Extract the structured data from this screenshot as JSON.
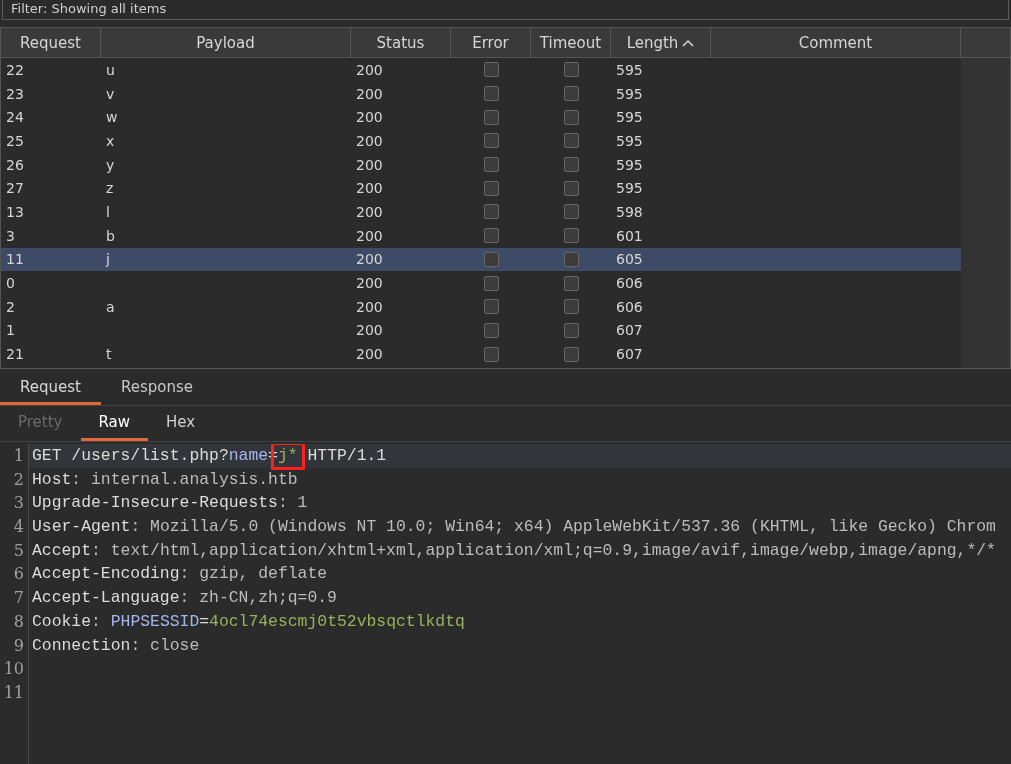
{
  "filter": {
    "text": "Filter: Showing all items"
  },
  "table": {
    "columns": [
      {
        "label": "Request",
        "sorted_ascending": false
      },
      {
        "label": "Payload",
        "sorted_ascending": false
      },
      {
        "label": "Status",
        "sorted_ascending": false
      },
      {
        "label": "Error",
        "sorted_ascending": false
      },
      {
        "label": "Timeout",
        "sorted_ascending": false
      },
      {
        "label": "Length",
        "sorted_ascending": true
      },
      {
        "label": "Comment",
        "sorted_ascending": false
      }
    ],
    "rows": [
      {
        "request": "22",
        "payload": "u",
        "status": "200",
        "error": false,
        "timeout": false,
        "length": "595",
        "selected": false
      },
      {
        "request": "23",
        "payload": "v",
        "status": "200",
        "error": false,
        "timeout": false,
        "length": "595",
        "selected": false
      },
      {
        "request": "24",
        "payload": "w",
        "status": "200",
        "error": false,
        "timeout": false,
        "length": "595",
        "selected": false
      },
      {
        "request": "25",
        "payload": "x",
        "status": "200",
        "error": false,
        "timeout": false,
        "length": "595",
        "selected": false
      },
      {
        "request": "26",
        "payload": "y",
        "status": "200",
        "error": false,
        "timeout": false,
        "length": "595",
        "selected": false
      },
      {
        "request": "27",
        "payload": "z",
        "status": "200",
        "error": false,
        "timeout": false,
        "length": "595",
        "selected": false
      },
      {
        "request": "13",
        "payload": "l",
        "status": "200",
        "error": false,
        "timeout": false,
        "length": "598",
        "selected": false
      },
      {
        "request": "3",
        "payload": "b",
        "status": "200",
        "error": false,
        "timeout": false,
        "length": "601",
        "selected": false
      },
      {
        "request": "11",
        "payload": "j",
        "status": "200",
        "error": false,
        "timeout": false,
        "length": "605",
        "selected": true
      },
      {
        "request": "0",
        "status": "200",
        "error": false,
        "timeout": false,
        "length": "606",
        "selected": false
      },
      {
        "request": "2",
        "payload": "a",
        "status": "200",
        "error": false,
        "timeout": false,
        "length": "606",
        "selected": false
      },
      {
        "request": "1",
        "status": "200",
        "error": false,
        "timeout": false,
        "length": "607",
        "selected": false
      },
      {
        "request": "21",
        "payload": "t",
        "status": "200",
        "error": false,
        "timeout": false,
        "length": "607",
        "selected": false
      }
    ]
  },
  "tabs": [
    {
      "label": "Request",
      "selected": true
    },
    {
      "label": "Response",
      "selected": false
    }
  ],
  "view_tabs": [
    {
      "label": "Pretty",
      "selected": false,
      "disabled": true
    },
    {
      "label": "Raw",
      "selected": true,
      "disabled": false
    },
    {
      "label": "Hex",
      "selected": false,
      "disabled": false
    }
  ],
  "editor": {
    "lines": [
      {
        "number": "1",
        "current": true,
        "segments": [
          {
            "text": "GET /users/list.php?",
            "kind": "plain"
          },
          {
            "text": "name",
            "kind": "param"
          },
          {
            "text": "=",
            "kind": "plain"
          },
          {
            "text": "j*",
            "kind": "param_value",
            "highlighted": true
          },
          {
            "text": " HTTP/1.1",
            "kind": "plain"
          }
        ]
      },
      {
        "number": "2",
        "current": false,
        "segments": [
          {
            "text": "Host",
            "kind": "header"
          },
          {
            "text": ": internal.analysis.htb",
            "kind": "value"
          }
        ]
      },
      {
        "number": "3",
        "current": false,
        "segments": [
          {
            "text": "Upgrade-Insecure-Requests",
            "kind": "header"
          },
          {
            "text": ": 1",
            "kind": "value"
          }
        ]
      },
      {
        "number": "4",
        "current": false,
        "segments": [
          {
            "text": "User-Agent",
            "kind": "header"
          },
          {
            "text": ": Mozilla/5.0 (Windows NT 10.0; Win64; x64) AppleWebKit/537.36 (KHTML, like Gecko) Chrom",
            "kind": "value"
          }
        ]
      },
      {
        "number": "5",
        "current": false,
        "segments": [
          {
            "text": "Accept",
            "kind": "header"
          },
          {
            "text": ": text/html,application/xhtml+xml,application/xml;q=0.9,image/avif,image/webp,image/apng,*/*",
            "kind": "value"
          }
        ]
      },
      {
        "number": "6",
        "current": false,
        "segments": [
          {
            "text": "Accept-Encoding",
            "kind": "header"
          },
          {
            "text": ": gzip, deflate",
            "kind": "value"
          }
        ]
      },
      {
        "number": "7",
        "current": false,
        "segments": [
          {
            "text": "Accept-Language",
            "kind": "header"
          },
          {
            "text": ": zh-CN,zh;q=0.9",
            "kind": "value"
          }
        ]
      },
      {
        "number": "8",
        "current": false,
        "segments": [
          {
            "text": "Cookie",
            "kind": "header"
          },
          {
            "text": ": ",
            "kind": "value"
          },
          {
            "text": "PHPSESSID",
            "kind": "param"
          },
          {
            "text": "=",
            "kind": "plain"
          },
          {
            "text": "4ocl74escmj0t52vbsqctlkdtq",
            "kind": "param_value",
            "highlighted": false
          }
        ]
      },
      {
        "number": "9",
        "current": false,
        "segments": [
          {
            "text": "Connection",
            "kind": "header"
          },
          {
            "text": ": close",
            "kind": "value"
          }
        ]
      },
      {
        "number": "10",
        "current": false
      },
      {
        "number": "11",
        "current": false
      }
    ]
  }
}
